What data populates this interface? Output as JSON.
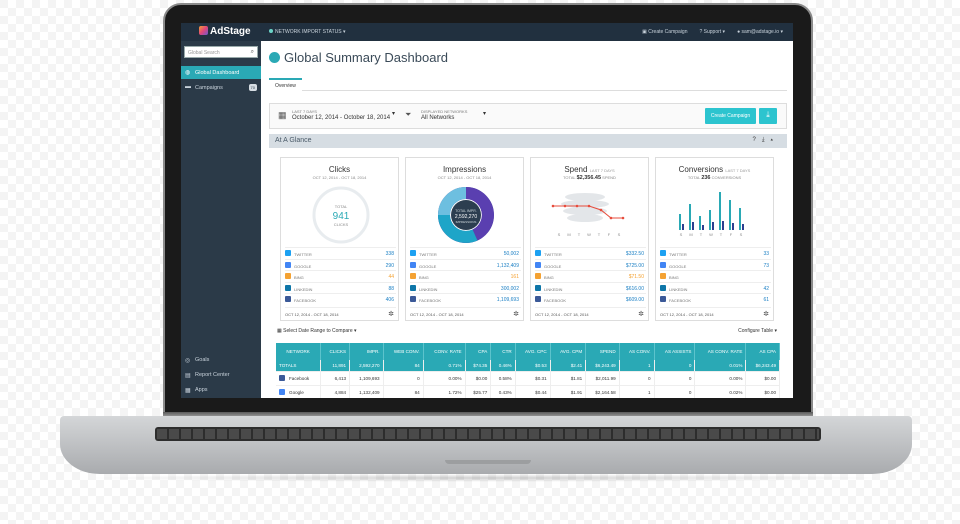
{
  "app": {
    "brand": "AdStage",
    "network_status": "NETWORK IMPORT STATUS"
  },
  "topbar": {
    "create_campaign": "Create Campaign",
    "support": "Support",
    "user": "sam@adstage.io"
  },
  "sidebar": {
    "search_placeholder": "Global Search",
    "items": [
      {
        "label": "Global Dashboard"
      },
      {
        "label": "Campaigns",
        "badge": "70"
      }
    ],
    "bottom": [
      {
        "label": "Goals"
      },
      {
        "label": "Report Center"
      },
      {
        "label": "Apps"
      }
    ]
  },
  "page": {
    "title": "Global Summary Dashboard",
    "tab": "Overview"
  },
  "filters": {
    "range_label": "LAST 7 DAYS",
    "range_value": "October 12, 2014 - October 18, 2014",
    "networks_label": "DISPLAYED NETWORKS",
    "networks_value": "All Networks",
    "create_button": "Create Campaign"
  },
  "glance": {
    "title": "At A Glance"
  },
  "cards": [
    {
      "title": "Clicks",
      "sub": "OCT 12, 2014 - OCT 18, 2014",
      "center_label": "TOTAL",
      "center_value": "941",
      "center_unit": "CLICKS",
      "values": [
        "338",
        "290",
        "44",
        "88",
        "406"
      ],
      "foot": "OCT 12, 2014 - OCT 18, 2014"
    },
    {
      "title": "Impressions",
      "sub": "OCT 12, 2014 - OCT 18, 2014",
      "center_label": "TOTAL IMPR.",
      "center_value": "2,592,270",
      "center_unit": "IMPRESSIONS",
      "values": [
        "50,002",
        "1,132,409",
        "161",
        "300,002",
        "1,109,693"
      ],
      "foot": "OCT 12, 2014 - OCT 18, 2014"
    },
    {
      "title": "Spend",
      "sub_prefix": "TOTAL",
      "sub_value": "$2,356.45",
      "sub_suffix": "SPEND",
      "title_note": "LAST 7 DAYS",
      "values": [
        "$332.50",
        "$725.00",
        "$71.50",
        "$616.00",
        "$609.00"
      ],
      "foot": "OCT 12, 2014 - OCT 18, 2014"
    },
    {
      "title": "Conversions",
      "title_note": "LAST 7 DAYS",
      "sub_prefix": "TOTAL",
      "sub_value": "236",
      "sub_suffix": "CONVERSIONS",
      "values": [
        "33",
        "73",
        "",
        "42",
        "61"
      ],
      "foot": "OCT 12, 2014 - OCT 18, 2014"
    }
  ],
  "networks": [
    "TWITTER",
    "GOOGLE",
    "BING",
    "LINKEDIN",
    "FACEBOOK"
  ],
  "network_colors": {
    "twitter": "#1da1f2",
    "google": "#4285f4",
    "bing": "#f4a233",
    "linkedin": "#0e76a8",
    "facebook": "#3b5998"
  },
  "days": [
    "S",
    "M",
    "T",
    "W",
    "T",
    "F",
    "S"
  ],
  "compare": "Select Date Range to Compare",
  "configure": "Configure Table",
  "table": {
    "headers": [
      "NETWORK",
      "CLICKS",
      "IMPR.",
      "WEB CONV.",
      "CONV. RATE",
      "CPA",
      "CTR",
      "AVG. CPC",
      "AVG. CPM",
      "SPEND",
      "AS CONV.",
      "AS ASSISTS",
      "AS CONV. RATE",
      "AS CPA"
    ],
    "totals": [
      "TOTALS",
      "11,891",
      "2,592,270",
      "84",
      "0.71%",
      "$74.35",
      "0.46%",
      "$0.53",
      "$2.41",
      "$6,243.49",
      "1",
      "0",
      "0.01%",
      "$6,243.49"
    ],
    "rows": [
      [
        "Facebook",
        "6,413",
        "1,109,693",
        "0",
        "0.00%",
        "$0.00",
        "0.58%",
        "$0.31",
        "$1.81",
        "$2,011.99",
        "0",
        "0",
        "0.00%",
        "$0.00"
      ],
      [
        "Google",
        "4,884",
        "1,132,409",
        "84",
        "1.72%",
        "$25.77",
        "0.43%",
        "$0.44",
        "$1.91",
        "$2,164.58",
        "1",
        "0",
        "0.02%",
        "$0.00"
      ]
    ]
  }
}
